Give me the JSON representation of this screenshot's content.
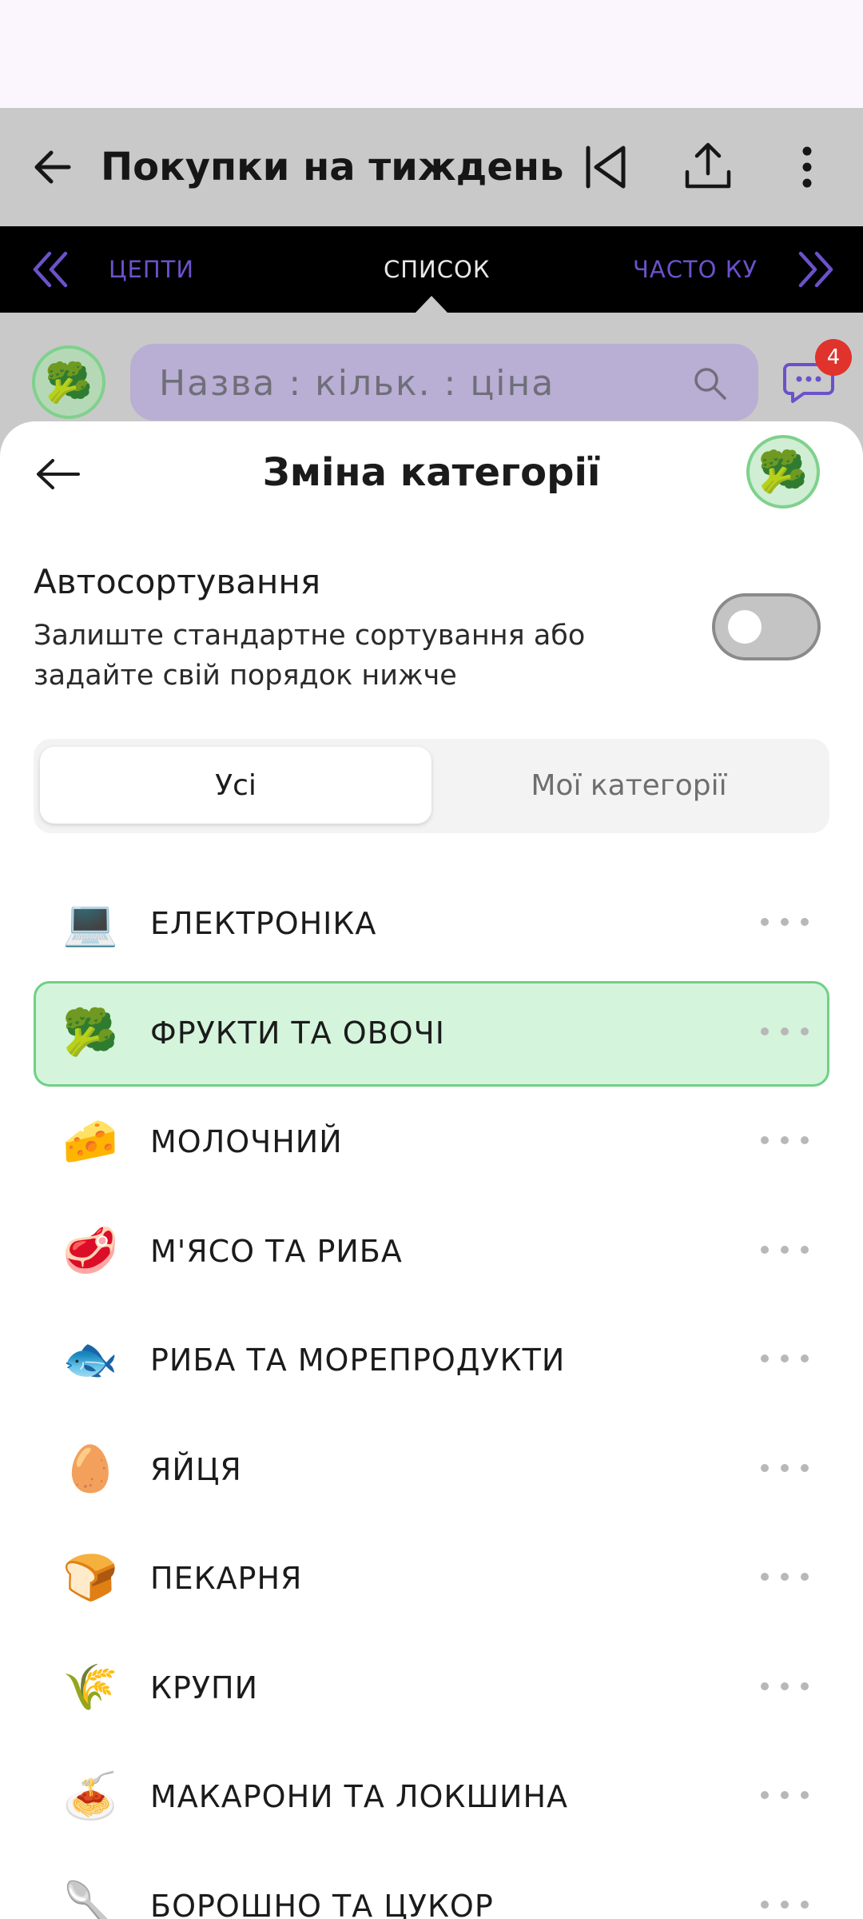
{
  "app_bar": {
    "title": "Покупки на тиждень",
    "back_icon": "arrow-left-icon",
    "icons": [
      "skip-back-icon",
      "share-icon",
      "more-vertical-icon"
    ]
  },
  "tabs": {
    "left": "ЦЕПТИ",
    "active": "СПИСОК",
    "right": "ЧАСТО КУП"
  },
  "search": {
    "placeholder": "Назва : кільк. : ціна",
    "avatar_emoji": "🥦",
    "chat_badge": "4"
  },
  "sheet": {
    "title": "Зміна категорії",
    "avatar_emoji": "🥦",
    "auto_sort": {
      "title": "Автосортування",
      "description": "Залиште стандартне сортування або задайте свій порядок нижче",
      "enabled": false
    },
    "segments": {
      "all": "Усі",
      "mine": "Мої категорії",
      "selected": "all"
    },
    "categories": [
      {
        "emoji": "💻",
        "label": "ЕЛЕКТРОНІКА"
      },
      {
        "emoji": "🥦",
        "label": "ФРУКТИ ТА ОВОЧІ"
      },
      {
        "emoji": "🧀",
        "label": "МОЛОЧНИЙ"
      },
      {
        "emoji": "🥩",
        "label": "М'ЯСО ТА РИБА"
      },
      {
        "emoji": "🐟",
        "label": "РИБА ТА МОРЕПРОДУКТИ"
      },
      {
        "emoji": "🥚",
        "label": "ЯЙЦЯ"
      },
      {
        "emoji": "🍞",
        "label": "ПЕКАРНЯ"
      },
      {
        "emoji": "🌾",
        "label": "КРУПИ"
      },
      {
        "emoji": "🍝",
        "label": "МАКАРОНИ ТА ЛОКШИНА"
      },
      {
        "emoji": "🥄",
        "label": "БОРОШНО ТА ЦУКОР"
      }
    ],
    "selected_category": "ФРУКТИ ТА ОВОЧІ"
  },
  "colors": {
    "accent": "#6b52c9",
    "selected_bg": "#d4f4dc",
    "selected_border": "#6fd084",
    "badge": "#e0332c"
  }
}
